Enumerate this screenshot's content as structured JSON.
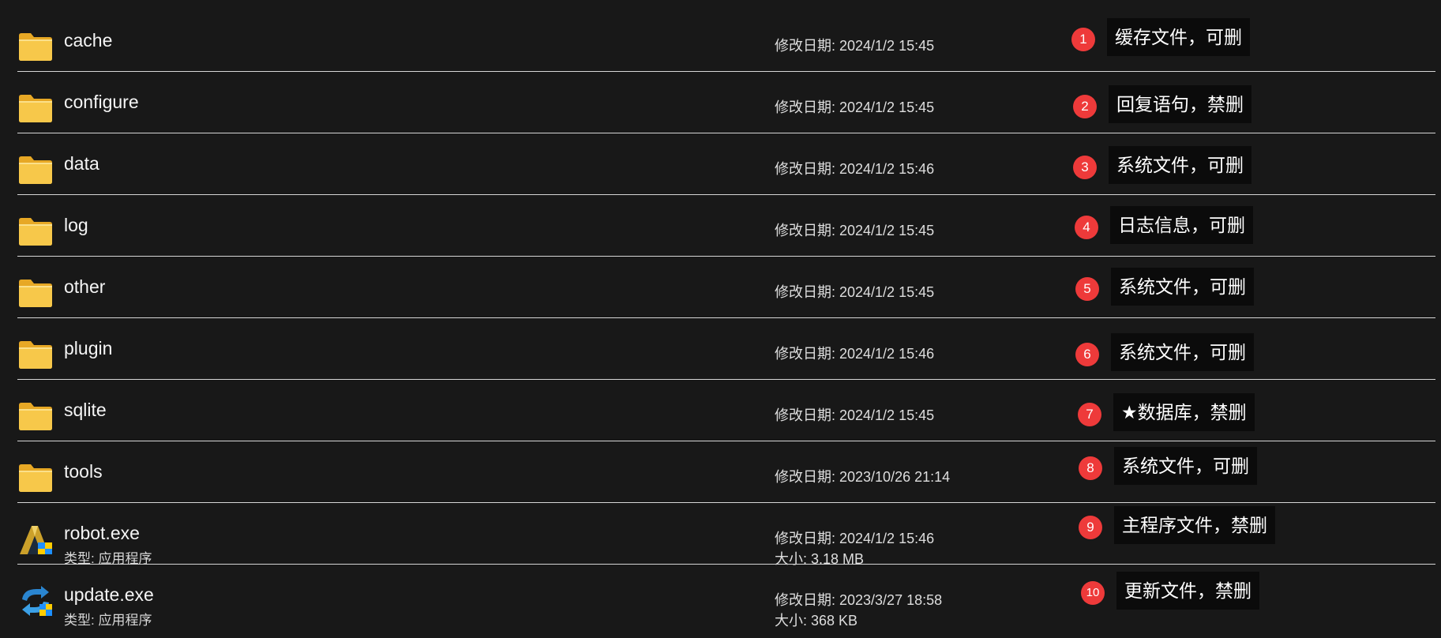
{
  "labels": {
    "modified_prefix": "修改日期: ",
    "type_prefix": "类型: ",
    "size_prefix": "大小: "
  },
  "items": [
    {
      "name": "cache",
      "icon": "folder-icon",
      "modified": "2024/1/2 15:45",
      "badge": "1",
      "note": "缓存文件，可删"
    },
    {
      "name": "configure",
      "icon": "folder-icon",
      "modified": "2024/1/2 15:45",
      "badge": "2",
      "note": "回复语句，禁删"
    },
    {
      "name": "data",
      "icon": "folder-icon",
      "modified": "2024/1/2 15:46",
      "badge": "3",
      "note": "系统文件，可删"
    },
    {
      "name": "log",
      "icon": "folder-icon",
      "modified": "2024/1/2 15:45",
      "badge": "4",
      "note": "日志信息，可删"
    },
    {
      "name": "other",
      "icon": "folder-icon",
      "modified": "2024/1/2 15:45",
      "badge": "5",
      "note": "系统文件，可删"
    },
    {
      "name": "plugin",
      "icon": "folder-icon",
      "modified": "2024/1/2 15:46",
      "badge": "6",
      "note": "系统文件，可删"
    },
    {
      "name": "sqlite",
      "icon": "folder-icon",
      "modified": "2024/1/2 15:45",
      "badge": "7",
      "note": "★数据库，禁删"
    },
    {
      "name": "tools",
      "icon": "folder-icon",
      "modified": "2023/10/26 21:14",
      "badge": "8",
      "note": "系统文件，可删"
    },
    {
      "name": "robot.exe",
      "icon": "robot-app-icon",
      "type": "应用程序",
      "modified": "2024/1/2 15:46",
      "size": "3.18 MB",
      "badge": "9",
      "note": "主程序文件，禁删"
    },
    {
      "name": "update.exe",
      "icon": "update-app-icon",
      "type": "应用程序",
      "modified": "2023/3/27 18:58",
      "size": "368 KB",
      "badge": "10",
      "note": "更新文件，禁删"
    }
  ],
  "colors": {
    "background": "#181818",
    "separator": "#d6d6d6",
    "badge": "#ee3a3a",
    "note_background": "#0b0b0b",
    "folder": "#f7c84a"
  }
}
